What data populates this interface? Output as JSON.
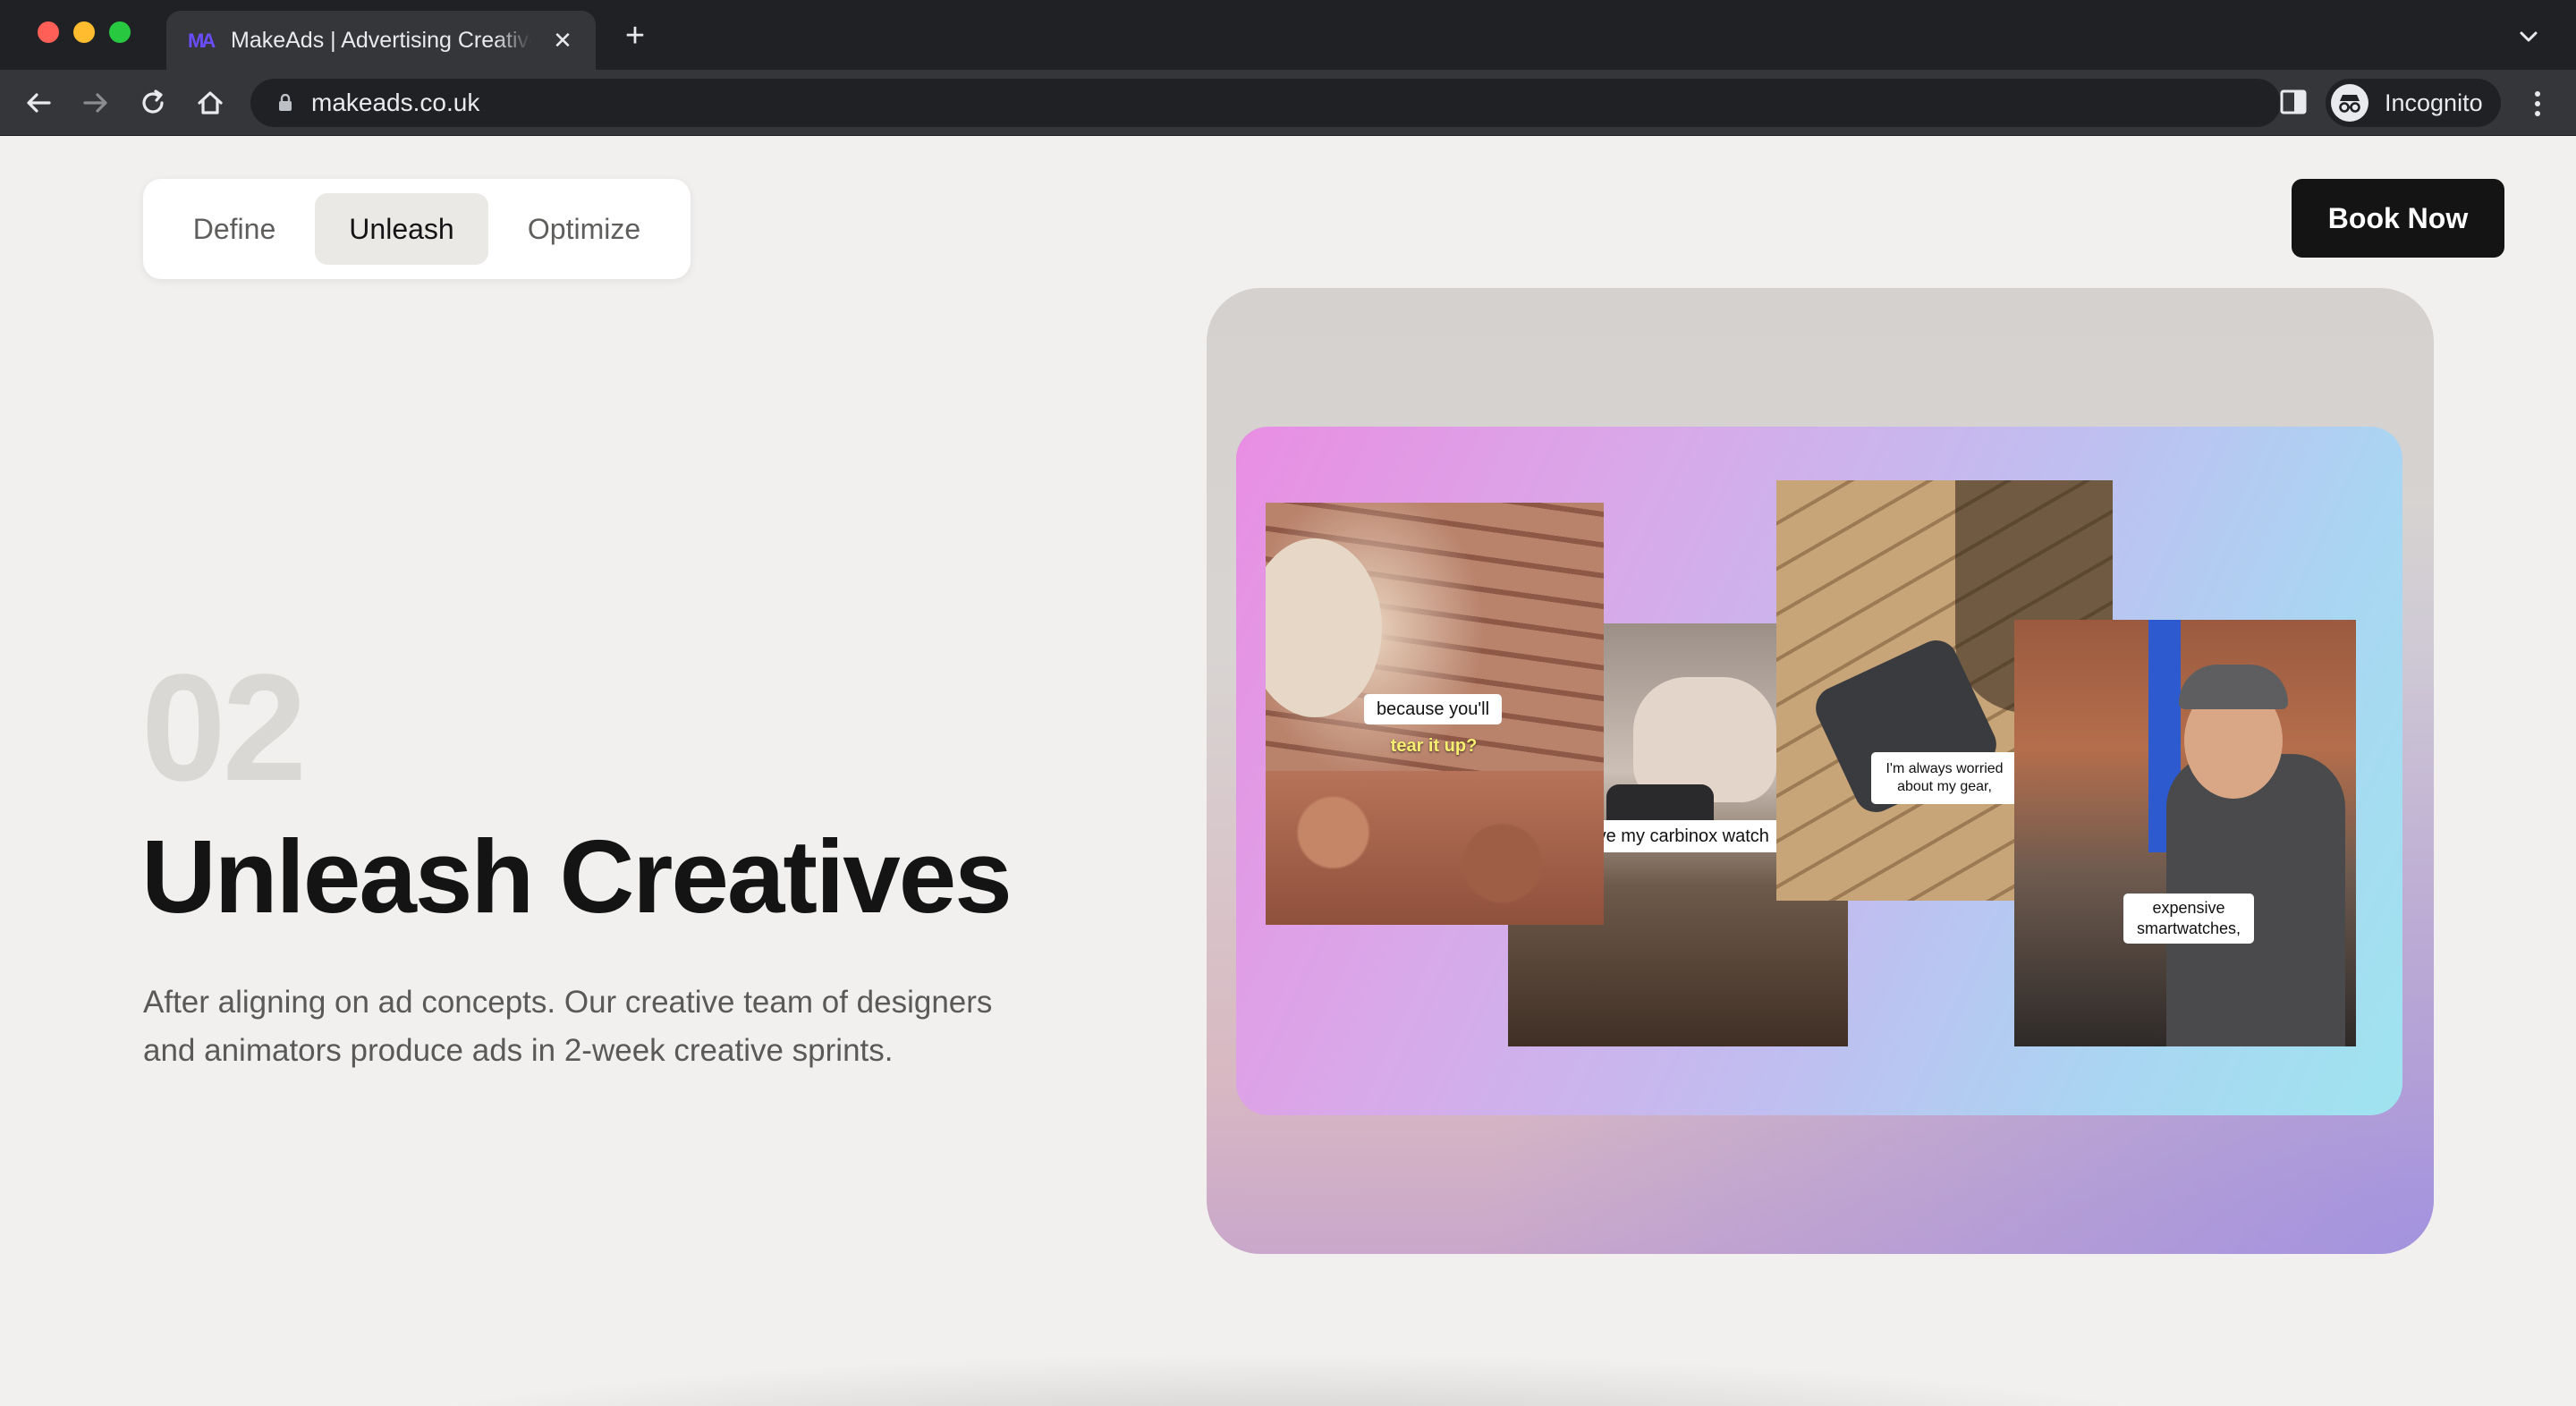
{
  "browser": {
    "tab": {
      "favicon_text": "MA",
      "title": "MakeAds | Advertising Creative",
      "close_glyph": "✕"
    },
    "new_tab_glyph": "+",
    "url": "makeads.co.uk",
    "profile_label": "Incognito",
    "icons": [
      "back-icon",
      "forward-icon",
      "reload-icon",
      "home-icon",
      "lock-icon",
      "star-icon",
      "side-panel-icon",
      "incognito-icon",
      "more-icon",
      "tab-search-icon"
    ]
  },
  "nav": {
    "steps": [
      {
        "label": "Define",
        "active": false
      },
      {
        "label": "Unleash",
        "active": true
      },
      {
        "label": "Optimize",
        "active": false
      }
    ],
    "cta_label": "Book Now"
  },
  "hero": {
    "step_number": "02",
    "title": "Unleash Creatives",
    "description": "After aligning on ad concepts. Our creative team of designers and animators produce ads in 2-week creative sprints."
  },
  "showcase": {
    "clips": [
      {
        "caption": "because you'll",
        "caption2": "tear it up?"
      },
      {
        "caption": "love my carbinox watch"
      },
      {
        "caption": "I'm always worried about my gear,"
      },
      {
        "caption": "expensive smartwatches,"
      }
    ]
  },
  "colors": {
    "background": "#f1f0ef",
    "primary_text": "#141414",
    "muted_text": "#5a5957",
    "step_number": "#d9d8d4",
    "button_bg": "#141414",
    "gradient_pink": "#e98ee3",
    "gradient_cyan": "#9fe4ef"
  }
}
